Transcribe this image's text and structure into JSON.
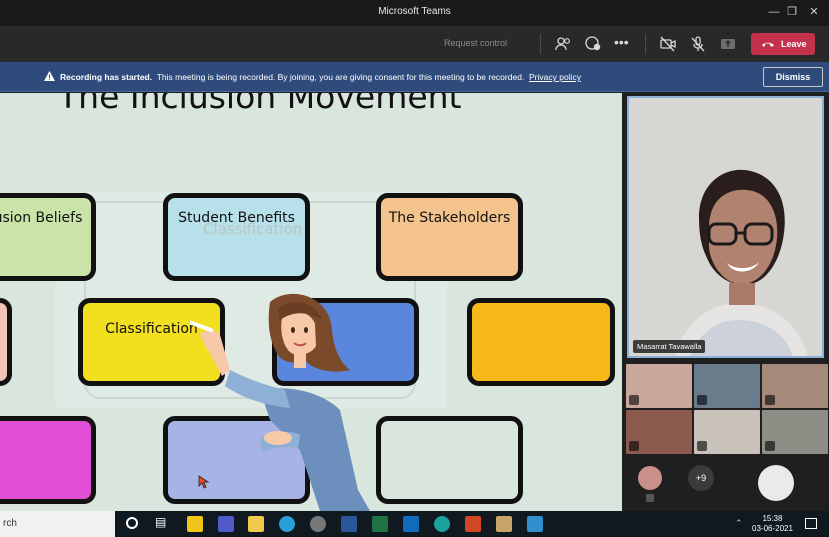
{
  "window": {
    "title": "Microsoft Teams"
  },
  "toolbar": {
    "request_control": "Request control",
    "leave_label": "Leave"
  },
  "banner": {
    "heading": "Recording has started.",
    "message": "This meeting is being recorded. By joining, you are giving consent for this meeting to be recorded.",
    "link": "Privacy policy",
    "dismiss_label": "Dismiss"
  },
  "slide": {
    "title": "The Inclusion Movement",
    "cards": [
      {
        "label": "usion Beliefs",
        "color": "#c9e3a8"
      },
      {
        "label": "Student Benefits",
        "color": "#b7e0ea"
      },
      {
        "label": "The Stakeholders",
        "color": "#f5c38e"
      },
      {
        "label": "Classification",
        "color": "#f2c3b7"
      },
      {
        "label": "",
        "color": "#f2df1f"
      },
      {
        "label": "",
        "color": "#5b86de"
      },
      {
        "label": "",
        "color": "#f7b81a"
      },
      {
        "label": "",
        "color": "#e24fd6"
      },
      {
        "label": "",
        "color": "#a7b3e4"
      }
    ],
    "ghost_label": "Classification"
  },
  "presenter": {
    "name": "Masarrat Tavawalla"
  },
  "participants": {
    "overflow_count": "+9"
  },
  "taskbar": {
    "search_text": "rch",
    "time": "15:38",
    "date": "03-06-2021"
  }
}
